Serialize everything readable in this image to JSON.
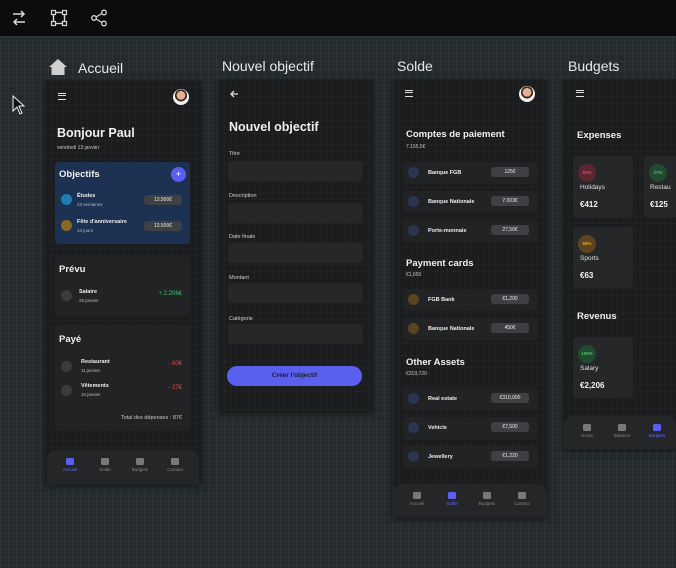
{
  "toolbar": {
    "tools": [
      "swap-icon",
      "vector-shape-icon",
      "share-icon"
    ]
  },
  "frames": {
    "accueil": {
      "label": "Accueil",
      "greeting": "Bonjour Paul",
      "date": "vendredi 13 janvier",
      "objectifs": {
        "title": "Objectifs",
        "add_label": "+",
        "items": [
          {
            "name": "Études",
            "sub": "23 semaines",
            "value": "13.500€"
          },
          {
            "name": "Fête d'anniversaire",
            "sub": "14 jours",
            "value": "13.500€"
          }
        ]
      },
      "prevu": {
        "title": "Prévu",
        "items": [
          {
            "name": "Salaire",
            "sub": "25 janvier",
            "value": "+ 2.206€"
          }
        ]
      },
      "paye": {
        "title": "Payé",
        "items": [
          {
            "name": "Restaurant",
            "sub": "11 janvier",
            "value": "- 60€"
          },
          {
            "name": "Vêtements",
            "sub": "10 janvier",
            "value": "- 27€"
          }
        ],
        "total": "Total des dépenses : 87€"
      }
    },
    "nouvel": {
      "label": "Nouvel objectif",
      "title": "Nouvel objectif",
      "fields": [
        "Titre",
        "Description",
        "Date finale",
        "Montant",
        "Catégorie"
      ],
      "submit": "Créer l'objectif"
    },
    "solde": {
      "label": "Solde",
      "groups": [
        {
          "title": "Comptes de paiement",
          "total": "7.155,5€",
          "items": [
            {
              "name": "Banque FGB",
              "value": "125€"
            },
            {
              "name": "Banque Nationale",
              "value": "7.003€"
            },
            {
              "name": "Porte-monnaie",
              "value": "27,50€"
            }
          ]
        },
        {
          "title": "Payment cards",
          "total": "€1,650",
          "items": [
            {
              "name": "FGB Bank",
              "value": "€1,200"
            },
            {
              "name": "Banque Nationale",
              "value": "450€"
            }
          ]
        },
        {
          "title": "Other Assets",
          "total": "€319,720",
          "items": [
            {
              "name": "Real estate",
              "value": "€310,000"
            },
            {
              "name": "Vehicle",
              "value": "€7,500"
            },
            {
              "name": "Jewellery",
              "value": "€1,220"
            }
          ]
        }
      ]
    },
    "budgets": {
      "label": "Budgets",
      "expenses_title": "Expenses",
      "expenses": [
        {
          "pct": "97%",
          "name": "Holidays",
          "amount": "€412",
          "color": "#e0566a"
        },
        {
          "pct": "27%",
          "name": "Restau",
          "amount": "€125",
          "color": "#4fc46e"
        },
        {
          "pct": "65%",
          "name": "Sports",
          "amount": "€63",
          "color": "#e7a23c"
        }
      ],
      "revenus_title": "Revenus",
      "revenus": [
        {
          "pct": "100%",
          "name": "Salary",
          "amount": "€2,206",
          "color": "#4fc46e"
        }
      ]
    }
  },
  "nav": [
    "Accueil",
    "Solde",
    "Budgets",
    "Contact"
  ],
  "nav_budgets": [
    "Home",
    "Balance",
    "Budgets"
  ],
  "colors": {
    "accent": "#5b5ff0",
    "positive": "#3ec46d",
    "negative": "#e24a4a"
  }
}
